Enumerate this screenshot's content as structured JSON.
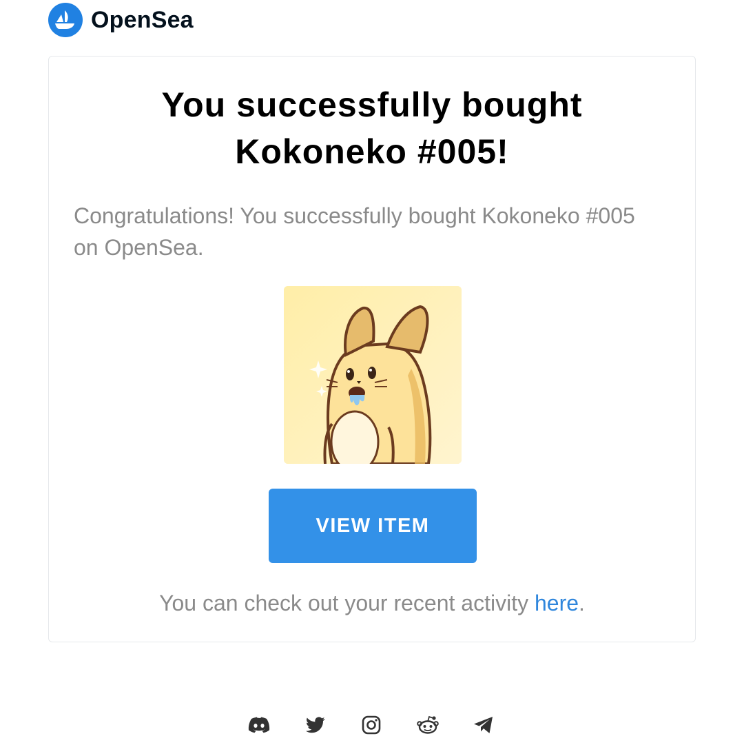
{
  "brand": {
    "name": "OpenSea"
  },
  "card": {
    "headline": "You successfully bought Kokoneko #005!",
    "message": "Congratulations! You successfully bought Kokoneko #005 on OpenSea.",
    "item_image_alt": "Kokoneko #005",
    "button_label": "VIEW ITEM",
    "footer_prefix": "You can check out your recent activity ",
    "footer_link": "here",
    "footer_suffix": "."
  },
  "social": [
    {
      "name": "discord-icon"
    },
    {
      "name": "twitter-icon"
    },
    {
      "name": "instagram-icon"
    },
    {
      "name": "reddit-icon"
    },
    {
      "name": "telegram-icon"
    }
  ],
  "colors": {
    "accent": "#2081e2",
    "button": "#3391e8",
    "link": "#2f86dc",
    "muted_text": "#8a8a8a",
    "icon": "#333333"
  }
}
